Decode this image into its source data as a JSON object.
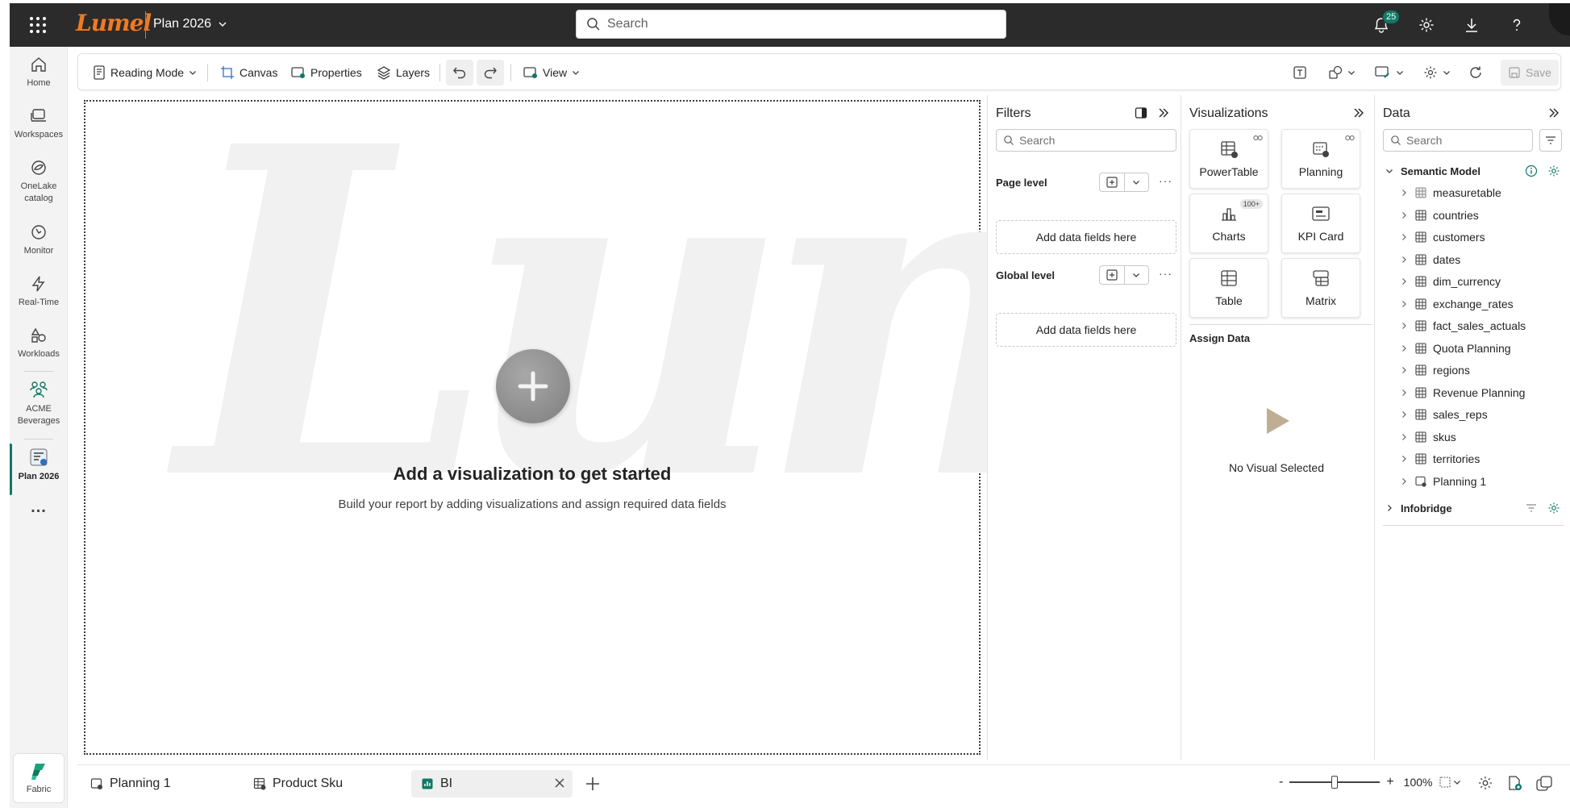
{
  "topbar": {
    "logo": "Lumel",
    "app_title": "Plan 2026",
    "search_placeholder": "Search",
    "notification_count": "25"
  },
  "left_rail": {
    "items": [
      {
        "label": "Home"
      },
      {
        "label": "Workspaces"
      },
      {
        "label": "OneLake catalog"
      },
      {
        "label": "Monitor"
      },
      {
        "label": "Real-Time"
      },
      {
        "label": "Workloads"
      },
      {
        "label": "ACME Beverages"
      },
      {
        "label": "Plan 2026"
      }
    ],
    "more": "...",
    "fabric": "Fabric"
  },
  "toolbar": {
    "reading_mode": "Reading Mode",
    "canvas": "Canvas",
    "properties": "Properties",
    "layers": "Layers",
    "view": "View",
    "save": "Save"
  },
  "canvas": {
    "watermark": "Lumel",
    "title": "Add a visualization to get started",
    "subtitle": "Build your report by adding visualizations and assign required data fields"
  },
  "filters": {
    "title": "Filters",
    "search_placeholder": "Search",
    "page_level": "Page level",
    "global_level": "Global level",
    "add_fields": "Add data fields here",
    "more": "···"
  },
  "visualizations": {
    "title": "Visualizations",
    "cards": [
      {
        "label": "PowerTable"
      },
      {
        "label": "Planning"
      },
      {
        "label": "Charts",
        "badge": "100+"
      },
      {
        "label": "KPI Card"
      },
      {
        "label": "Table"
      },
      {
        "label": "Matrix"
      }
    ],
    "assign_data": "Assign Data",
    "no_visual": "No Visual Selected"
  },
  "data": {
    "title": "Data",
    "search_placeholder": "Search",
    "semantic_model": "Semantic Model",
    "tables": [
      "measuretable",
      "countries",
      "customers",
      "dates",
      "dim_currency",
      "exchange_rates",
      "fact_sales_actuals",
      "Quota Planning",
      "regions",
      "Revenue Planning",
      "sales_reps",
      "skus",
      "territories",
      "Planning 1"
    ],
    "infobridge": "Infobridge"
  },
  "bottombar": {
    "tabs": [
      {
        "label": "Planning 1"
      },
      {
        "label": "Product Sku"
      },
      {
        "label": "BI"
      }
    ],
    "zoom_minus": "-",
    "zoom_plus": "+",
    "zoom_level": "100%"
  },
  "colors": {
    "accent": "#117865",
    "topbar": "#2b2b2b",
    "logo": "#f07a22"
  }
}
